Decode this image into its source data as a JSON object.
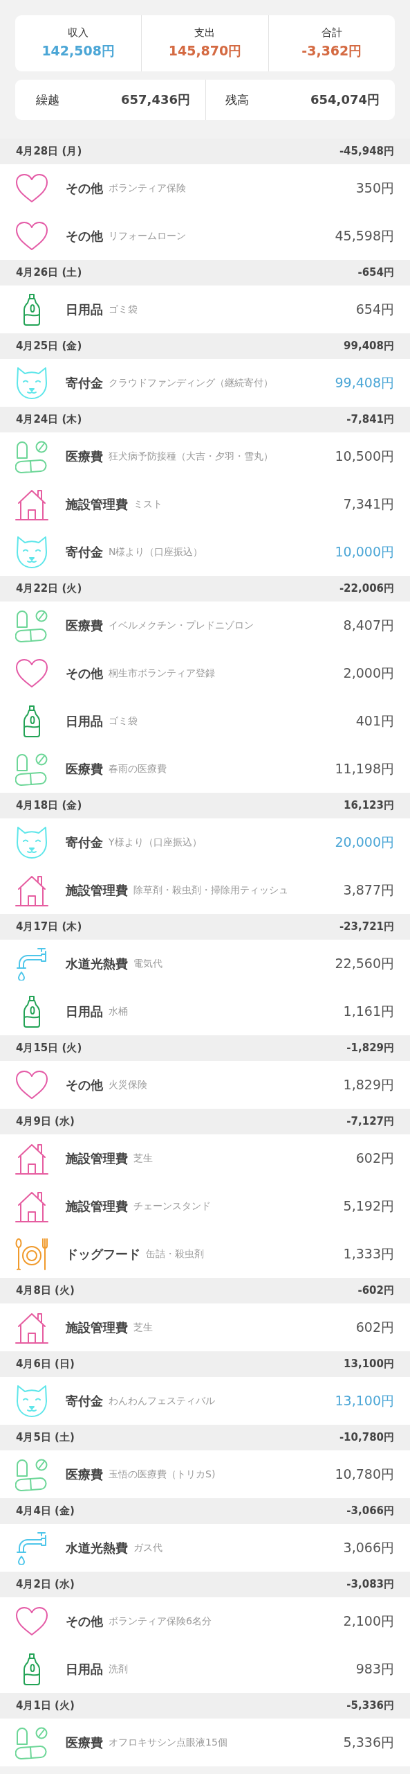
{
  "summary": {
    "items": [
      {
        "label": "収入",
        "value": "142,508円",
        "kind": "income"
      },
      {
        "label": "支出",
        "value": "145,870円",
        "kind": "expense"
      },
      {
        "label": "合計",
        "value": "-3,362円",
        "kind": "expense"
      }
    ]
  },
  "balance": {
    "items": [
      {
        "label": "繰越",
        "value": "657,436円"
      },
      {
        "label": "残高",
        "value": "654,074円"
      }
    ]
  },
  "days": [
    {
      "date": "4月28日 (月)",
      "total": "-45,948円",
      "entries": [
        {
          "kind": "heart",
          "category": "その他",
          "memo": "ボランティア保険",
          "amount": "350円",
          "income": false
        },
        {
          "kind": "heart",
          "category": "その他",
          "memo": "リフォームローン",
          "amount": "45,598円",
          "income": false
        }
      ]
    },
    {
      "date": "4月26日 (土)",
      "total": "-654円",
      "entries": [
        {
          "kind": "bottle",
          "category": "日用品",
          "memo": "ゴミ袋",
          "amount": "654円",
          "income": false
        }
      ]
    },
    {
      "date": "4月25日 (金)",
      "total": "99,408円",
      "entries": [
        {
          "kind": "dog",
          "category": "寄付金",
          "memo": "クラウドファンディング（継続寄付）",
          "amount": "99,408円",
          "income": true
        }
      ]
    },
    {
      "date": "4月24日 (木)",
      "total": "-7,841円",
      "entries": [
        {
          "kind": "pills",
          "category": "医療費",
          "memo": "狂犬病予防接種（大吉・夕羽・雪丸）",
          "amount": "10,500円",
          "income": false
        },
        {
          "kind": "house",
          "category": "施設管理費",
          "memo": "ミスト",
          "amount": "7,341円",
          "income": false
        },
        {
          "kind": "dog",
          "category": "寄付金",
          "memo": "N様より（口座振込）",
          "amount": "10,000円",
          "income": true
        }
      ]
    },
    {
      "date": "4月22日 (火)",
      "total": "-22,006円",
      "entries": [
        {
          "kind": "pills",
          "category": "医療費",
          "memo": "イベルメクチン・プレドニゾロン",
          "amount": "8,407円",
          "income": false
        },
        {
          "kind": "heart",
          "category": "その他",
          "memo": "桐生市ボランティア登録",
          "amount": "2,000円",
          "income": false
        },
        {
          "kind": "bottle",
          "category": "日用品",
          "memo": "ゴミ袋",
          "amount": "401円",
          "income": false
        },
        {
          "kind": "pills",
          "category": "医療費",
          "memo": "春雨の医療費",
          "amount": "11,198円",
          "income": false
        }
      ]
    },
    {
      "date": "4月18日 (金)",
      "total": "16,123円",
      "entries": [
        {
          "kind": "dog",
          "category": "寄付金",
          "memo": "Y様より（口座振込）",
          "amount": "20,000円",
          "income": true
        },
        {
          "kind": "house",
          "category": "施設管理費",
          "memo": "除草剤・殺虫剤・掃除用ティッシュ",
          "amount": "3,877円",
          "income": false
        }
      ]
    },
    {
      "date": "4月17日 (木)",
      "total": "-23,721円",
      "entries": [
        {
          "kind": "faucet",
          "category": "水道光熱費",
          "memo": "電気代",
          "amount": "22,560円",
          "income": false
        },
        {
          "kind": "bottle",
          "category": "日用品",
          "memo": "水桶",
          "amount": "1,161円",
          "income": false
        }
      ]
    },
    {
      "date": "4月15日 (火)",
      "total": "-1,829円",
      "entries": [
        {
          "kind": "heart",
          "category": "その他",
          "memo": "火災保険",
          "amount": "1,829円",
          "income": false
        }
      ]
    },
    {
      "date": "4月9日 (水)",
      "total": "-7,127円",
      "entries": [
        {
          "kind": "house",
          "category": "施設管理費",
          "memo": "芝生",
          "amount": "602円",
          "income": false
        },
        {
          "kind": "house",
          "category": "施設管理費",
          "memo": "チェーンスタンド",
          "amount": "5,192円",
          "income": false
        },
        {
          "kind": "food",
          "category": "ドッグフード",
          "memo": "缶詰・殺虫剤",
          "amount": "1,333円",
          "income": false
        }
      ]
    },
    {
      "date": "4月8日 (火)",
      "total": "-602円",
      "entries": [
        {
          "kind": "house",
          "category": "施設管理費",
          "memo": "芝生",
          "amount": "602円",
          "income": false
        }
      ]
    },
    {
      "date": "4月6日 (日)",
      "total": "13,100円",
      "entries": [
        {
          "kind": "dog",
          "category": "寄付金",
          "memo": "わんわんフェスティバル",
          "amount": "13,100円",
          "income": true
        }
      ]
    },
    {
      "date": "4月5日 (土)",
      "total": "-10,780円",
      "entries": [
        {
          "kind": "pills",
          "category": "医療費",
          "memo": "玉悟の医療費（トリカS)",
          "amount": "10,780円",
          "income": false
        }
      ]
    },
    {
      "date": "4月4日 (金)",
      "total": "-3,066円",
      "entries": [
        {
          "kind": "faucet",
          "category": "水道光熱費",
          "memo": "ガス代",
          "amount": "3,066円",
          "income": false
        }
      ]
    },
    {
      "date": "4月2日 (水)",
      "total": "-3,083円",
      "entries": [
        {
          "kind": "heart",
          "category": "その他",
          "memo": "ボランティア保険6名分",
          "amount": "2,100円",
          "income": false
        },
        {
          "kind": "bottle",
          "category": "日用品",
          "memo": "洗剤",
          "amount": "983円",
          "income": false
        }
      ]
    },
    {
      "date": "4月1日 (火)",
      "total": "-5,336円",
      "entries": [
        {
          "kind": "pills",
          "category": "医療費",
          "memo": "オフロキサシン点眼液15個",
          "amount": "5,336円",
          "income": false
        }
      ]
    }
  ]
}
